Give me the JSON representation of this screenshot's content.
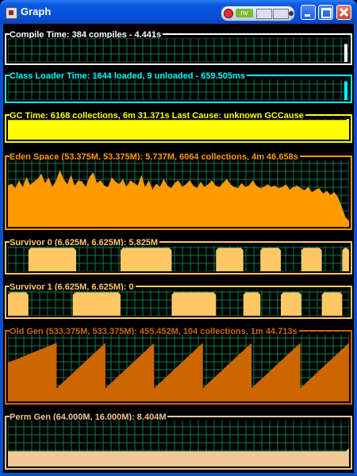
{
  "window": {
    "title": "Graph",
    "nvidia_label": "nv"
  },
  "panels": [
    {
      "label": "Compile Time: 384 compiles - 4.441s",
      "color": "#ffffff",
      "mode": "spike",
      "values": [
        0,
        0,
        0,
        0,
        0,
        0,
        0,
        0,
        0,
        0,
        0,
        0,
        0,
        0,
        0,
        0,
        0,
        0,
        0,
        0,
        0,
        0,
        0,
        0,
        0,
        0,
        0,
        0,
        0,
        0,
        0,
        0,
        0,
        0,
        0,
        0,
        0,
        0,
        0,
        0,
        0,
        0,
        0,
        0,
        0,
        0,
        0,
        0,
        0,
        0.75
      ]
    },
    {
      "label": "Class Loader Time: 1644 loaded, 9 unloaded - 659.505ms",
      "color": "#00ffff",
      "mode": "spike",
      "values": [
        0,
        0,
        0,
        0,
        0,
        0,
        0,
        0,
        0,
        0,
        0,
        0,
        0,
        0,
        0,
        0,
        0,
        0,
        0,
        0,
        0,
        0,
        0,
        0,
        0,
        0,
        0,
        0,
        0,
        0,
        0,
        0,
        0,
        0,
        0,
        0,
        0,
        0,
        0,
        0,
        0,
        0,
        0,
        0,
        0,
        0,
        0,
        0,
        0,
        0.9
      ]
    },
    {
      "label": "GC Time: 6168 collections, 6m 31.371s  Last Cause: unknown GCCause",
      "color": "#ffff00",
      "mode": "full",
      "level": 0.95
    },
    {
      "label": "Eden Space (53.375M, 53.375M): 5.737M, 6064 collections, 4m 46.658s",
      "color": "#ff9a00",
      "mode": "area",
      "values": [
        0.62,
        0.65,
        0.58,
        0.7,
        0.6,
        0.75,
        0.63,
        0.68,
        0.72,
        0.8,
        0.66,
        0.74,
        0.6,
        0.7,
        0.85,
        0.72,
        0.64,
        0.78,
        0.62,
        0.7,
        0.68,
        0.6,
        0.75,
        0.82,
        0.66,
        0.7,
        0.62,
        0.6,
        0.74,
        0.68,
        0.64,
        0.72,
        0.6,
        0.7,
        0.66,
        0.62,
        0.78,
        0.6,
        0.7,
        0.56,
        0.65,
        0.6,
        0.72,
        0.62,
        0.58,
        0.66,
        0.7,
        0.6,
        0.64,
        0.7,
        0.62,
        0.58,
        0.68,
        0.6,
        0.64,
        0.7,
        0.62,
        0.6,
        0.66,
        0.72,
        0.64,
        0.6,
        0.58,
        0.66,
        0.6,
        0.62,
        0.7,
        0.62,
        0.58,
        0.6,
        0.64,
        0.6,
        0.62,
        0.58,
        0.6,
        0.64,
        0.56,
        0.6,
        0.62,
        0.58,
        0.55,
        0.6,
        0.52,
        0.56,
        0.58,
        0.5,
        0.54,
        0.48,
        0.52,
        0.45,
        0.3,
        0.15,
        0.08
      ]
    },
    {
      "label": "Survivor 0 (6.625M, 6.625M): 5.825M",
      "color": "#ffc864",
      "mode": "blocks",
      "blocks": [
        [
          0.06,
          0.2
        ],
        [
          0.33,
          0.48
        ],
        [
          0.61,
          0.69
        ],
        [
          0.74,
          0.8
        ],
        [
          0.86,
          0.92
        ],
        [
          0.98,
          1.0
        ]
      ],
      "level": 0.92
    },
    {
      "label": "Survivor 1 (6.625M, 6.625M): 0",
      "color": "#ffc864",
      "mode": "blocks",
      "blocks": [
        [
          0.0,
          0.06
        ],
        [
          0.19,
          0.33
        ],
        [
          0.48,
          0.61
        ],
        [
          0.69,
          0.74
        ],
        [
          0.8,
          0.86
        ],
        [
          0.92,
          0.98
        ]
      ],
      "level": 0.92
    },
    {
      "label": "Old Gen (533.375M, 533.375M): 455.452M, 104 collections, 1m 44.713s",
      "color": "#cc6600",
      "mode": "saw",
      "teeth": 7,
      "low": 0.2,
      "high": 0.88,
      "first_low": 0.58
    },
    {
      "label": "Perm Gen (64.000M, 16.000M): 8.404M",
      "color": "#f0c896",
      "mode": "full",
      "level": 0.33
    }
  ]
}
